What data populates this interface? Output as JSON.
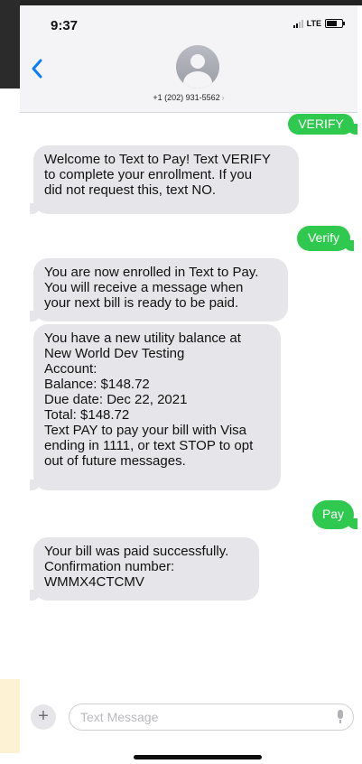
{
  "status_bar": {
    "time": "9:37",
    "network": "LTE"
  },
  "header": {
    "back_icon": "chevron-left-icon",
    "contact": "+1 (202) 931-5562",
    "contact_chevron": "›"
  },
  "messages": [
    {
      "type": "sent",
      "text": "VERIFY"
    },
    {
      "type": "received",
      "text": "Welcome to Text to Pay! Text VERIFY\nto complete your enrollment. If you\ndid not request this, text NO."
    },
    {
      "type": "sent",
      "text": "Verify"
    },
    {
      "type": "received",
      "text": "You are now enrolled in Text to Pay.\nYou will receive a message when\nyour next bill is ready to be paid."
    },
    {
      "type": "received",
      "text": "You have a new utility balance at\nNew World Dev Testing\nAccount:\nBalance: $148.72\nDue date: Dec 22, 2021\nTotal: $148.72\nText PAY to pay your bill with Visa\nending in 1111, or text STOP to opt\nout of future messages."
    },
    {
      "type": "sent",
      "text": "Pay"
    },
    {
      "type": "received",
      "text": "Your bill was paid successfully.\nConfirmation number:\nWMMX4CTCMV"
    }
  ],
  "composer": {
    "plus_label": "+",
    "placeholder": "Text Message"
  },
  "colors": {
    "sent_bubble": "#30c94f",
    "received_bubble": "#e6e6ea",
    "accent": "#0a7cff"
  }
}
